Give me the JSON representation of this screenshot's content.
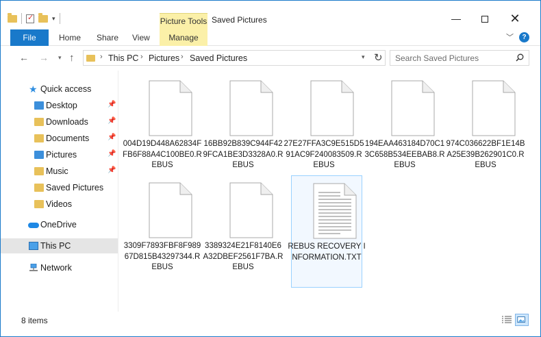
{
  "window": {
    "title": "Saved Pictures",
    "contextual_tab_group": "Picture Tools",
    "controls": {
      "minimize": "—",
      "maximize": "",
      "close": "✕"
    }
  },
  "ribbon": {
    "tabs": [
      {
        "id": "file",
        "label": "File"
      },
      {
        "id": "home",
        "label": "Home"
      },
      {
        "id": "share",
        "label": "Share"
      },
      {
        "id": "view",
        "label": "View"
      },
      {
        "id": "manage",
        "label": "Manage"
      }
    ],
    "help_label": "?"
  },
  "address": {
    "path": [
      "This PC",
      "Pictures",
      "Saved Pictures"
    ],
    "separator": "›"
  },
  "search": {
    "placeholder": "Search Saved Pictures"
  },
  "sidebar": {
    "items": [
      {
        "label": "Quick access",
        "icon": "star-icon",
        "pinned": false,
        "indent": 1
      },
      {
        "label": "Desktop",
        "icon": "folder-blue-icon",
        "pinned": true,
        "indent": 2
      },
      {
        "label": "Downloads",
        "icon": "downloads-folder-icon",
        "pinned": true,
        "indent": 2
      },
      {
        "label": "Documents",
        "icon": "documents-folder-icon",
        "pinned": true,
        "indent": 2
      },
      {
        "label": "Pictures",
        "icon": "pictures-folder-icon",
        "pinned": true,
        "indent": 2
      },
      {
        "label": "Music",
        "icon": "music-folder-icon",
        "pinned": true,
        "indent": 2
      },
      {
        "label": "Saved Pictures",
        "icon": "folder-icon",
        "pinned": false,
        "indent": 2
      },
      {
        "label": "Videos",
        "icon": "videos-folder-icon",
        "pinned": false,
        "indent": 2
      },
      {
        "label": "OneDrive",
        "icon": "onedrive-icon",
        "pinned": false,
        "indent": 1
      },
      {
        "label": "This PC",
        "icon": "this-pc-icon",
        "pinned": false,
        "indent": 1,
        "selected": true
      },
      {
        "label": "Network",
        "icon": "network-icon",
        "pinned": false,
        "indent": 1
      }
    ],
    "pin_glyph": "📌"
  },
  "files": [
    {
      "name": "004D19D448A62834FFB6F88A4C100BE0.REBUS",
      "type": "blank"
    },
    {
      "name": "16BB92B839C944F429FCA1BE3D3328A0.REBUS",
      "type": "blank"
    },
    {
      "name": "27E27FFA3C9E515D591AC9F240083509.REBUS",
      "type": "blank"
    },
    {
      "name": "194EAA463184D70C13C658B534EEBAB8.REBUS",
      "type": "blank"
    },
    {
      "name": "974C036622BF1E14BA25E39B262901C0.REBUS",
      "type": "blank"
    },
    {
      "name": "3309F7893FBF8F98967D815B43297344.REBUS",
      "type": "blank"
    },
    {
      "name": "3389324E21F8140E6A32DBEF2561F7BA.REBUS",
      "type": "blank"
    },
    {
      "name": "REBUS RECOVERY INFORMATION.TXT",
      "type": "text",
      "selected": true
    }
  ],
  "status": {
    "item_count": "8 items"
  },
  "colors": {
    "accent": "#1979ca",
    "contextual_tab": "#fbf0a8",
    "folder": "#e8c15a",
    "selection": "#cce8ff"
  }
}
